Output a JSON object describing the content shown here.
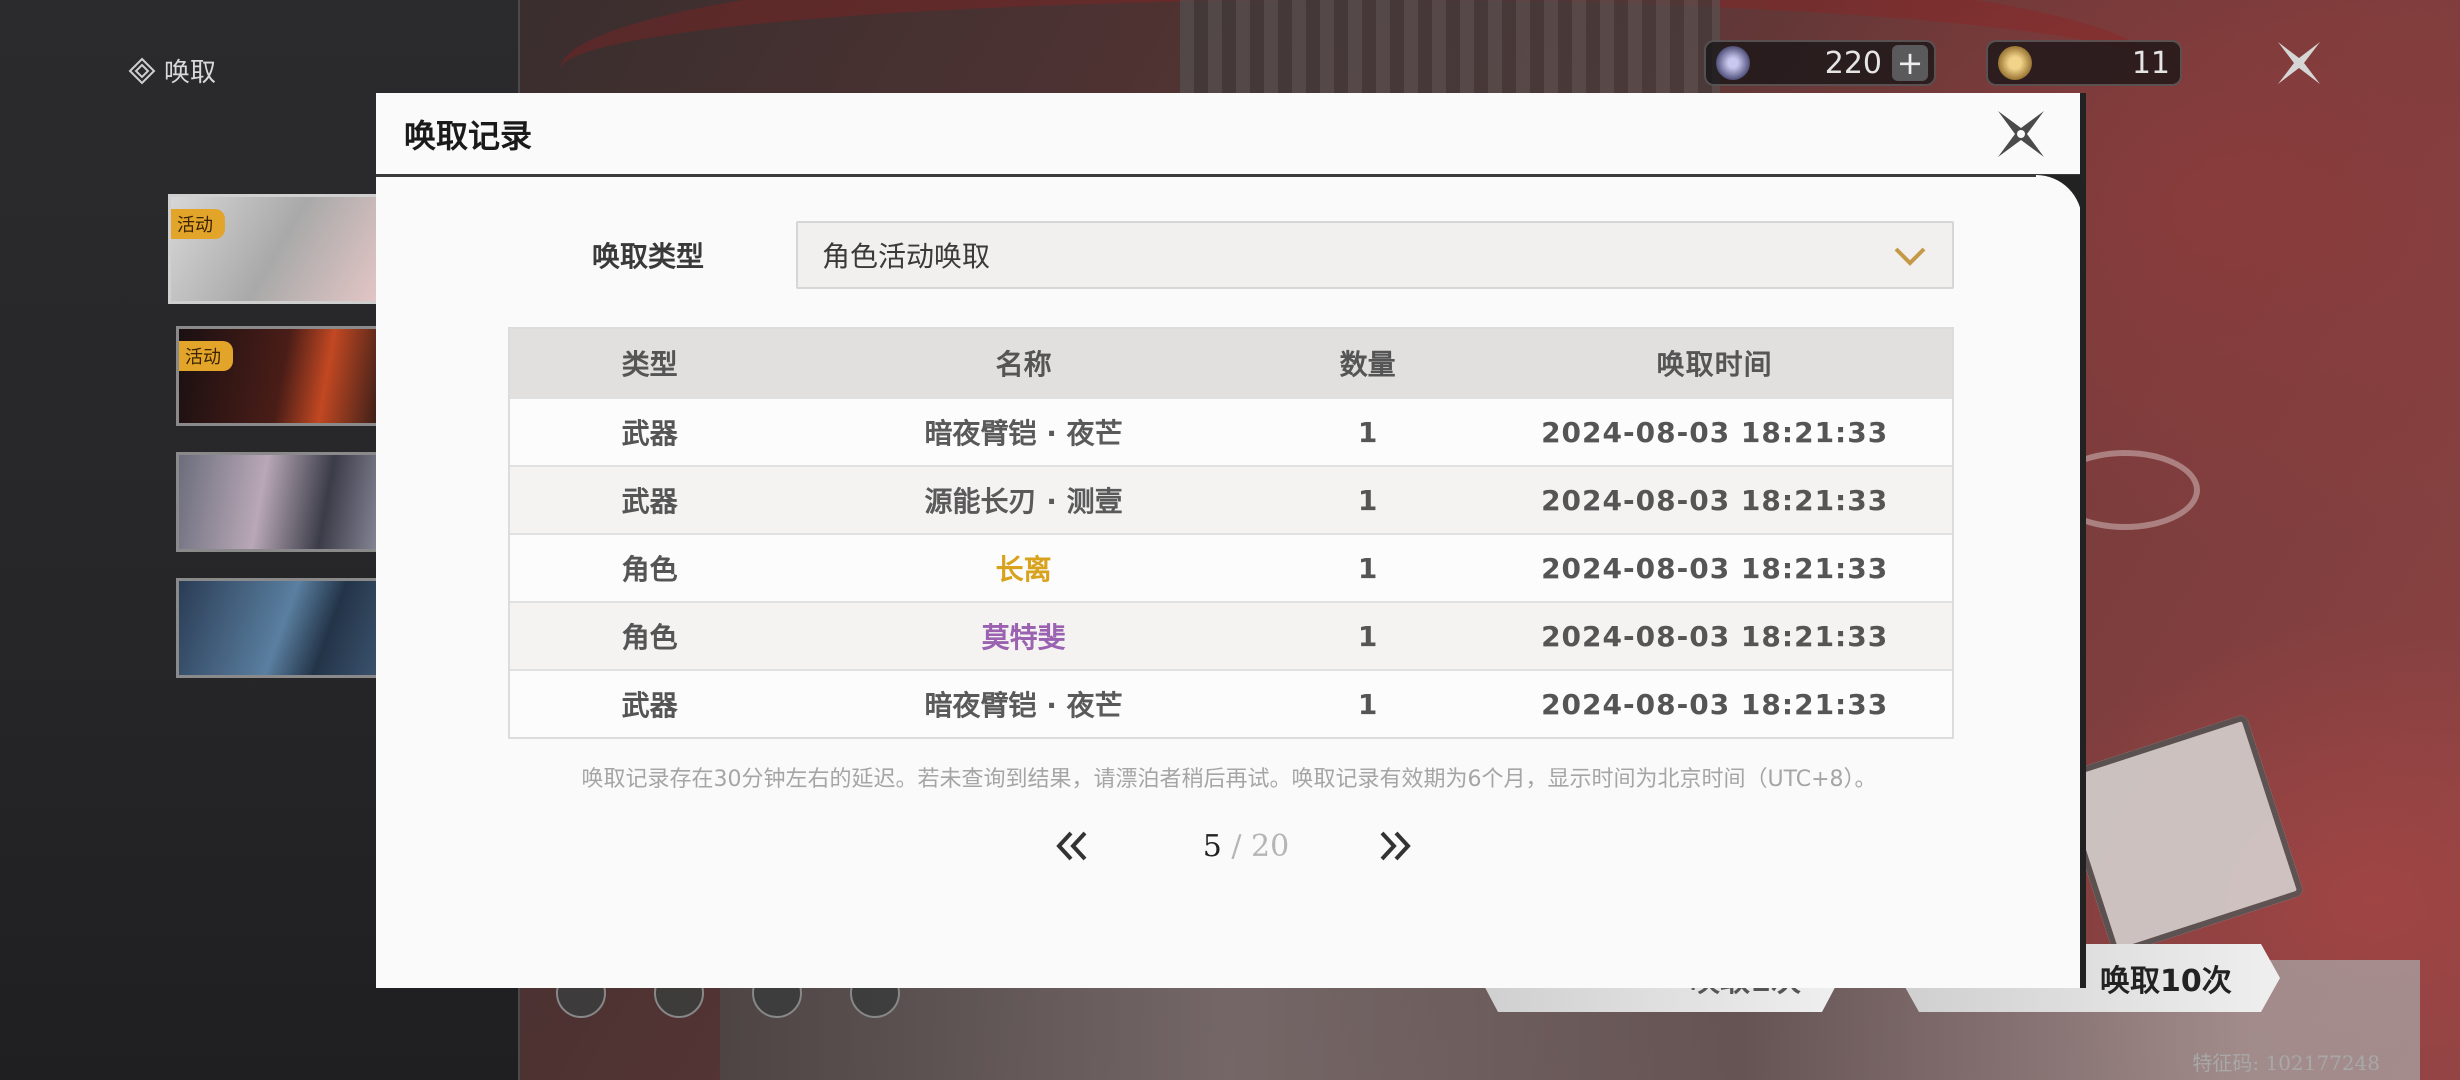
{
  "app": {
    "section_title": "唤取",
    "currencies": [
      {
        "name": "astrite",
        "icon": "astrite-icon",
        "value": "220",
        "plus": "+"
      },
      {
        "name": "lustrous-tide",
        "icon": "lustrous-tide-icon",
        "value": "11"
      }
    ],
    "banners": [
      {
        "tag": "活动"
      },
      {
        "tag": "活动"
      },
      {
        "tag": ""
      },
      {
        "tag": ""
      }
    ],
    "pull_1_label": "唤取1次",
    "pull_10_label": "唤取10次",
    "feature_code": "特征码: 102177248"
  },
  "modal": {
    "title": "唤取记录",
    "type_label": "唤取类型",
    "type_selected": "角色活动唤取",
    "columns": [
      "类型",
      "名称",
      "数量",
      "唤取时间"
    ],
    "rows": [
      {
        "type": "武器",
        "name": "暗夜臂铠 · 夜芒",
        "qty": "1",
        "time": "2024-08-03 18:21:33",
        "rarity_color": "#5a5a5a"
      },
      {
        "type": "武器",
        "name": "源能长刃 · 测壹",
        "qty": "1",
        "time": "2024-08-03 18:21:33",
        "rarity_color": "#5a5a5a"
      },
      {
        "type": "角色",
        "name": "长离",
        "qty": "1",
        "time": "2024-08-03 18:21:33",
        "rarity_color": "#d9a21c"
      },
      {
        "type": "角色",
        "name": "莫特斐",
        "qty": "1",
        "time": "2024-08-03 18:21:33",
        "rarity_color": "#9a62b0"
      },
      {
        "type": "武器",
        "name": "暗夜臂铠 · 夜芒",
        "qty": "1",
        "time": "2024-08-03 18:21:33",
        "rarity_color": "#5a5a5a"
      }
    ],
    "note": "唤取记录存在30分钟左右的延迟。若未查询到结果，请漂泊者稍后再试。唤取记录有效期为6个月，显示时间为北京时间（UTC+8）。",
    "pager": {
      "current": "5",
      "separator": " / ",
      "total": "20"
    }
  }
}
